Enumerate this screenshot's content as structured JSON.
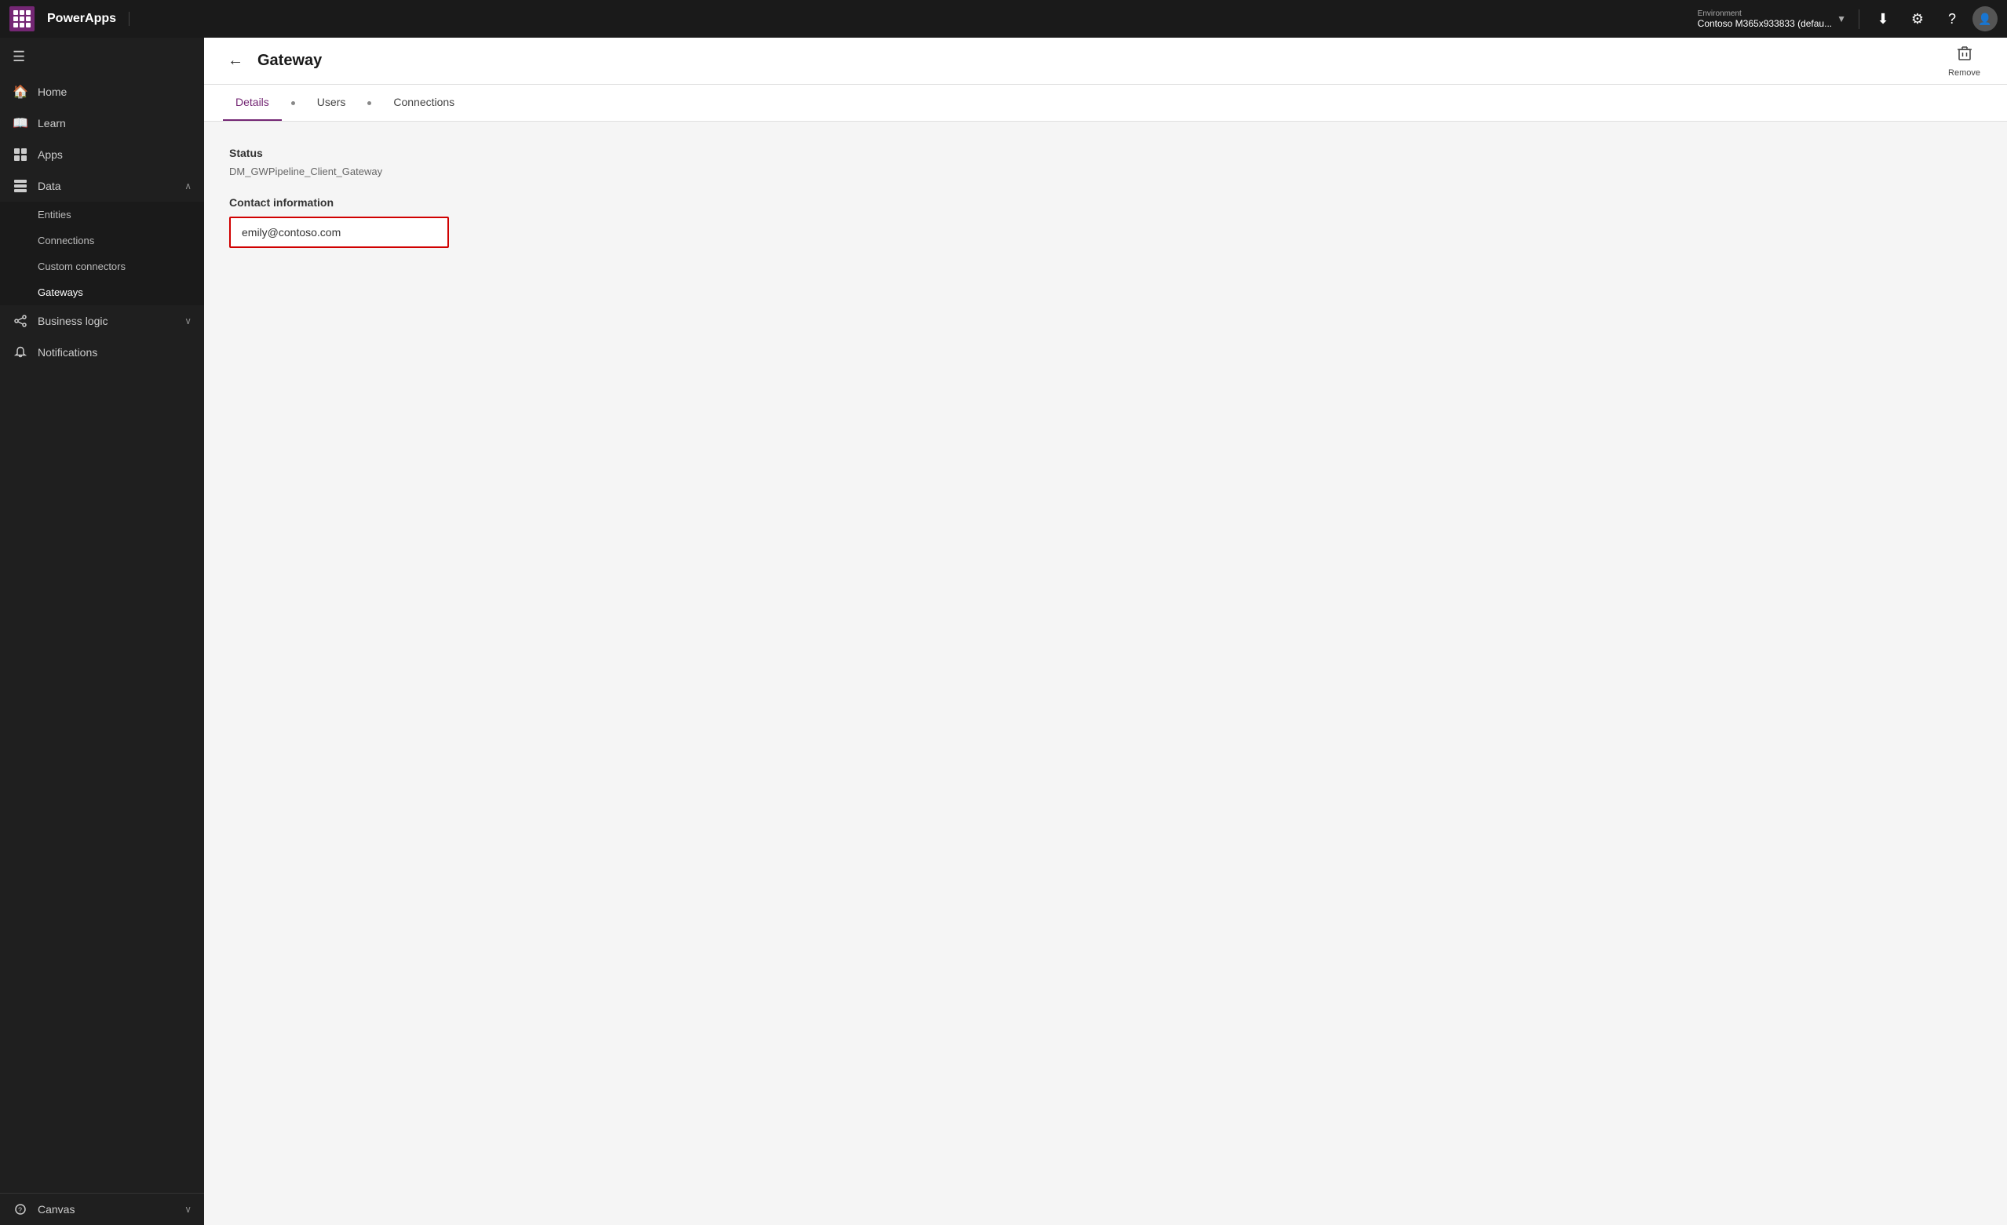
{
  "topbar": {
    "app_name": "PowerApps",
    "environment_label": "Environment",
    "environment_name": "Contoso M365x933833 (defau...",
    "download_icon": "⬇",
    "settings_icon": "⚙",
    "help_icon": "?",
    "avatar_text": "👤"
  },
  "sidebar": {
    "menu_icon": "☰",
    "items": [
      {
        "id": "home",
        "label": "Home",
        "icon": "🏠",
        "active": false
      },
      {
        "id": "learn",
        "label": "Learn",
        "icon": "📖",
        "active": false
      },
      {
        "id": "apps",
        "label": "Apps",
        "icon": "⬜",
        "active": false
      },
      {
        "id": "data",
        "label": "Data",
        "icon": "📊",
        "active": true,
        "expanded": true,
        "chevron": "∧"
      }
    ],
    "data_subitems": [
      {
        "id": "entities",
        "label": "Entities",
        "active": false
      },
      {
        "id": "connections",
        "label": "Connections",
        "active": false
      },
      {
        "id": "custom-connectors",
        "label": "Custom connectors",
        "active": false
      },
      {
        "id": "gateways",
        "label": "Gateways",
        "active": true
      }
    ],
    "bottom_items": [
      {
        "id": "business-logic",
        "label": "Business logic",
        "icon": "⚙",
        "chevron": "∨"
      },
      {
        "id": "notifications",
        "label": "Notifications",
        "icon": "🔔"
      }
    ],
    "footer_items": [
      {
        "id": "canvas",
        "label": "Canvas",
        "icon": "❓",
        "chevron": "∨"
      }
    ]
  },
  "page": {
    "title": "Gateway",
    "back_label": "←",
    "remove_label": "Remove"
  },
  "tabs": [
    {
      "id": "details",
      "label": "Details",
      "active": true
    },
    {
      "id": "users",
      "label": "Users",
      "active": false
    },
    {
      "id": "connections",
      "label": "Connections",
      "active": false
    }
  ],
  "details": {
    "status_label": "Status",
    "status_value": "DM_GWPipeline_Client_Gateway",
    "contact_label": "Contact information",
    "contact_placeholder": "emily@contoso.com",
    "contact_value": "emily@contoso.com"
  }
}
